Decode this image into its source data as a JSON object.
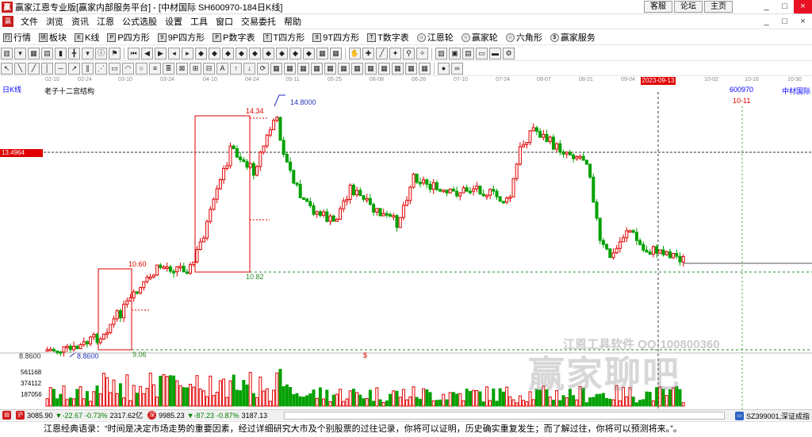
{
  "window": {
    "title": "赢家江恩专业版[赢家内部服务平台] - [中材国际  SH600970-184日K线]",
    "links": [
      "客服",
      "论坛",
      "主页"
    ],
    "controls": [
      "_",
      "□",
      "×"
    ]
  },
  "menu": {
    "items": [
      "文件",
      "浏览",
      "资讯",
      "江恩",
      "公式选股",
      "设置",
      "工具",
      "窗口",
      "交易委托",
      "帮助"
    ],
    "controls": [
      "_",
      "□",
      "×"
    ]
  },
  "toolbar1": {
    "items": [
      {
        "icon": "行",
        "label": "行情"
      },
      {
        "icon": "块",
        "label": "板块"
      },
      {
        "icon": "K",
        "label": "K线"
      },
      {
        "icon": "P",
        "label": "P四方形"
      },
      {
        "icon": "9",
        "label": "9P四方形"
      },
      {
        "icon": "P",
        "label": "P数字表"
      },
      {
        "icon": "T",
        "label": "T四方形"
      },
      {
        "icon": "9",
        "label": "9T四方形"
      },
      {
        "icon": "T",
        "label": "T数字表"
      },
      {
        "icon": "○",
        "label": "江恩轮"
      },
      {
        "icon": "○",
        "label": "赢家轮"
      },
      {
        "icon": "○",
        "label": "六角形"
      },
      {
        "icon": "$",
        "label": "赢家服务"
      }
    ]
  },
  "date_axis": {
    "ticks": [
      "02-10",
      "02-24",
      "03-10",
      "03-24",
      "04-10",
      "04-24",
      "05-11",
      "05-25",
      "06-08",
      "06-26",
      "07-10",
      "07-24",
      "08-07",
      "08-21",
      "09-04",
      "10-02",
      "10-16",
      "10-30"
    ],
    "highlight": "2023-09-13"
  },
  "chart": {
    "period": "日K线",
    "structure": "老子十二宫结构",
    "code": "600970",
    "name": "中材国际",
    "price_level_label": "13.4964",
    "price_colors": {
      "up": "#e00000",
      "down": "#00a000",
      "box": "#e00000"
    },
    "annotations": {
      "high": "14.8000",
      "box_top": "14.34",
      "box_bottom": "10.82",
      "box1_top": "10.60",
      "box1_bottom": "9.06",
      "low": "8.8600",
      "left_low": "8.8600",
      "future": "10-11",
      "dollar": "$"
    },
    "volume_ticks": [
      "561168",
      "374112",
      "187056"
    ]
  },
  "watermark": {
    "top": "江恩工具软件  QQ:100800360",
    "main": "赢家聊吧"
  },
  "status": {
    "index1": {
      "value": "3085.90",
      "change": "▼-22.67",
      "pct": "-0.73%",
      "amount": "2317.62亿"
    },
    "index2": {
      "value": "9985.23",
      "change": "▼-87.23",
      "pct": "-0.87%",
      "amount": "3187.13"
    },
    "right": "SZ399001,深证成指"
  },
  "quote": "江恩经典语录：“时间是决定市场走势的重要因素，经过详细研究大市及个别股票的过往记录，你将可以证明，历史确实重复发生；而了解过往，你将可以预测将来。”。"
}
